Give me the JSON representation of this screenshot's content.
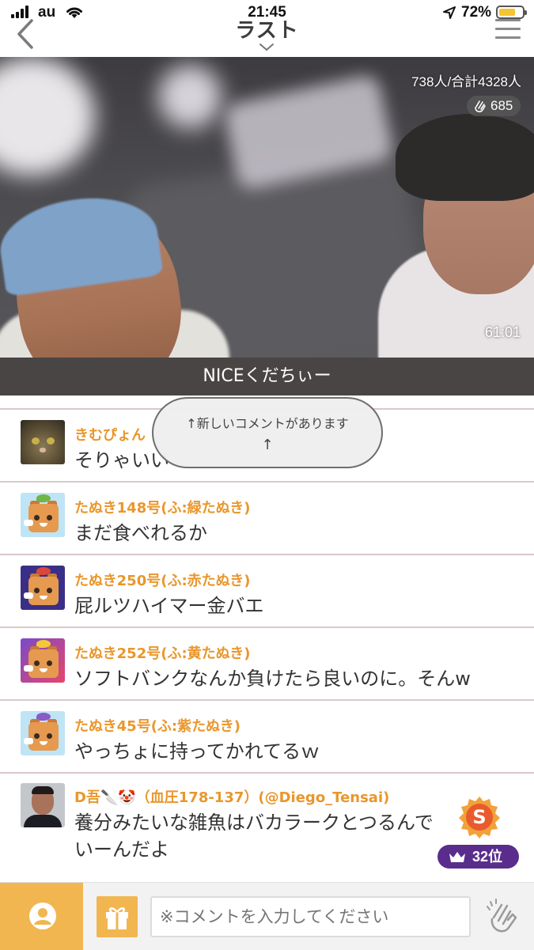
{
  "status_bar": {
    "carrier": "au",
    "time": "21:45",
    "battery_percent": "72%",
    "battery_level": 0.72
  },
  "nav": {
    "title": "ラスト"
  },
  "stream": {
    "viewers": "738人/合計4328人",
    "applause_count": "685",
    "duration": "61:01",
    "caption": "NICEくだちぃー"
  },
  "toast": {
    "line1": "↑新しいコメントがあります",
    "line2": "↑"
  },
  "comments": [
    {
      "name": "きむぴょん",
      "text": "そりゃいい"
    },
    {
      "name": "たぬき148号(ふ:緑たぬき)",
      "text": "まだ食べれるか"
    },
    {
      "name": "たぬき250号(ふ:赤たぬき)",
      "text": "屁ルツハイマー金バエ"
    },
    {
      "name": "たぬき252号(ふ:黄たぬき)",
      "text": "ソフトバンクなんか負けたら良いのに。そんw"
    },
    {
      "name": "たぬき45号(ふ:紫たぬき)",
      "text": "やっちょに持ってかれてるｗ"
    },
    {
      "name": "D吾🔪🤡（血圧178-137）(@Diego_Tensai)",
      "text": "養分みたいな雑魚はバカラークとつるんで",
      "text2": "いーんだよ"
    }
  ],
  "rank_badge": "32位",
  "input": {
    "placeholder": "※コメントを入力してください"
  },
  "colors": {
    "accent": "#f1b650",
    "name_color": "#e9972c",
    "rank_purple": "#5a2d8c"
  }
}
